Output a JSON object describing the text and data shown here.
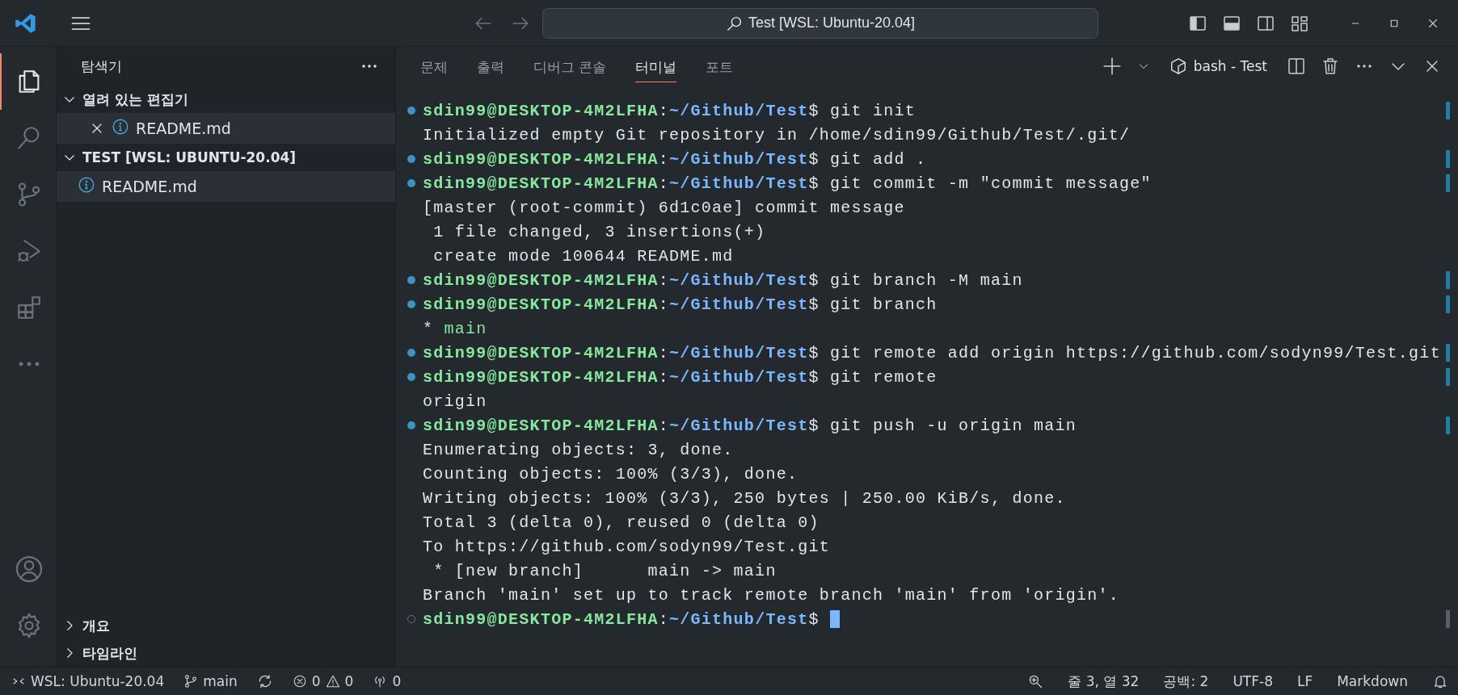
{
  "title_bar": {
    "title": "Test [WSL: Ubuntu-20.04]"
  },
  "activity_bar": {
    "items": [
      {
        "kind": "files",
        "selected": true
      },
      {
        "kind": "search",
        "selected": false
      },
      {
        "kind": "source-control",
        "selected": false
      },
      {
        "kind": "run-debug",
        "selected": false
      },
      {
        "kind": "extensions",
        "selected": false
      },
      {
        "kind": "more",
        "selected": false
      }
    ],
    "bottom_items": [
      {
        "kind": "account"
      },
      {
        "kind": "settings"
      }
    ]
  },
  "sidebar": {
    "title": "탐색기",
    "sections": [
      {
        "title": "열려 있는 편집기",
        "expanded": true,
        "items": [
          {
            "label": "README.md",
            "closable": true,
            "selected": true
          }
        ]
      },
      {
        "title": "TEST [WSL: UBUNTU-20.04]",
        "expanded": true,
        "items": [
          {
            "label": "README.md",
            "closable": false,
            "selected": true
          }
        ]
      }
    ],
    "bottom_sections": [
      {
        "title": "개요",
        "expanded": false
      },
      {
        "title": "타임라인",
        "expanded": false
      }
    ]
  },
  "panel": {
    "tabs": [
      {
        "label": "문제",
        "selected": false
      },
      {
        "label": "출력",
        "selected": false
      },
      {
        "label": "디버그 콘솔",
        "selected": false
      },
      {
        "label": "터미널",
        "selected": true
      },
      {
        "label": "포트",
        "selected": false
      }
    ],
    "terminal_name": "bash - Test"
  },
  "terminal": {
    "lines": [
      {
        "kind": "prompt",
        "succeeded": true,
        "user": "sdin99@DESKTOP-4M2LFHA",
        "separator": ":",
        "path": "~/Github/Test",
        "command": "$ git init"
      },
      {
        "kind": "output",
        "text": "Initialized empty Git repository in /home/sdin99/Github/Test/.git/"
      },
      {
        "kind": "prompt",
        "succeeded": true,
        "user": "sdin99@DESKTOP-4M2LFHA",
        "separator": ":",
        "path": "~/Github/Test",
        "command": "$ git add ."
      },
      {
        "kind": "prompt",
        "succeeded": true,
        "user": "sdin99@DESKTOP-4M2LFHA",
        "separator": ":",
        "path": "~/Github/Test",
        "command": "$ git commit -m \"commit message\""
      },
      {
        "kind": "output",
        "text": "[master (root-commit) 6d1c0ae] commit message"
      },
      {
        "kind": "output",
        "text": " 1 file changed, 3 insertions(+)"
      },
      {
        "kind": "output",
        "text": " create mode 100644 README.md"
      },
      {
        "kind": "prompt",
        "succeeded": true,
        "user": "sdin99@DESKTOP-4M2LFHA",
        "separator": ":",
        "path": "~/Github/Test",
        "command": "$ git branch -M main"
      },
      {
        "kind": "prompt",
        "succeeded": true,
        "user": "sdin99@DESKTOP-4M2LFHA",
        "separator": ":",
        "path": "~/Github/Test",
        "command": "$ git branch"
      },
      {
        "kind": "branch",
        "marker": "*",
        "text": "main"
      },
      {
        "kind": "prompt",
        "succeeded": true,
        "user": "sdin99@DESKTOP-4M2LFHA",
        "separator": ":",
        "path": "~/Github/Test",
        "command": "$ git remote add origin https://github.com/sodyn99/Test.git"
      },
      {
        "kind": "prompt",
        "succeeded": true,
        "user": "sdin99@DESKTOP-4M2LFHA",
        "separator": ":",
        "path": "~/Github/Test",
        "command": "$ git remote"
      },
      {
        "kind": "output",
        "text": "origin"
      },
      {
        "kind": "prompt",
        "succeeded": true,
        "user": "sdin99@DESKTOP-4M2LFHA",
        "separator": ":",
        "path": "~/Github/Test",
        "command": "$ git push -u origin main"
      },
      {
        "kind": "output",
        "text": "Enumerating objects: 3, done."
      },
      {
        "kind": "output",
        "text": "Counting objects: 100% (3/3), done."
      },
      {
        "kind": "output",
        "text": "Writing objects: 100% (3/3), 250 bytes | 250.00 KiB/s, done."
      },
      {
        "kind": "output",
        "text": "Total 3 (delta 0), reused 0 (delta 0)"
      },
      {
        "kind": "output",
        "text": "To https://github.com/sodyn99/Test.git"
      },
      {
        "kind": "output",
        "text": " * [new branch]      main -> main"
      },
      {
        "kind": "output",
        "text": "Branch 'main' set up to track remote branch 'main' from 'origin'."
      },
      {
        "kind": "prompt",
        "succeeded": false,
        "user": "sdin99@DESKTOP-4M2LFHA",
        "separator": ":",
        "path": "~/Github/Test",
        "command": "$",
        "cursor": true
      }
    ]
  },
  "status_bar": {
    "remote": "WSL: Ubuntu-20.04",
    "branch": "main",
    "errors": "0",
    "warnings": "0",
    "ports": "0",
    "position": "줄 3, 열 32",
    "indentation": "공백: 2",
    "encoding": "UTF-8",
    "line_ending": "LF",
    "language": "Markdown"
  }
}
